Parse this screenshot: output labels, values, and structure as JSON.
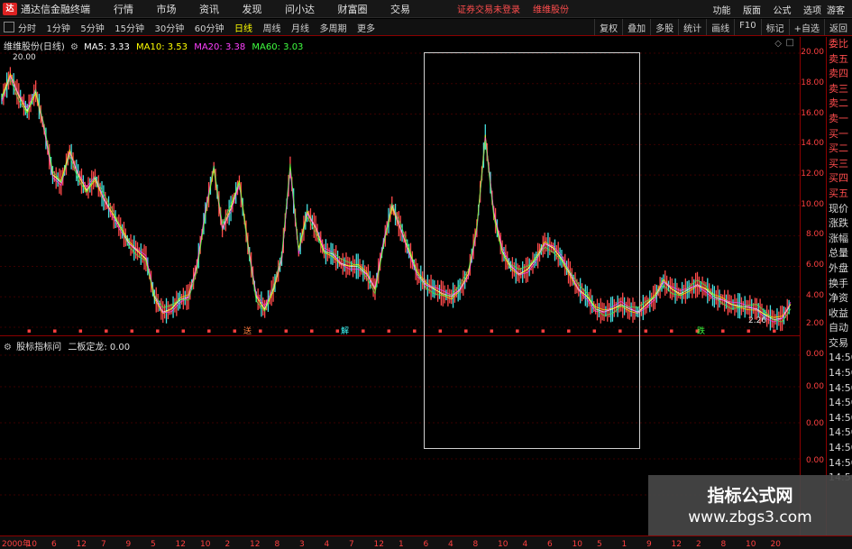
{
  "app": {
    "title": "通达信金融终端",
    "menu": [
      "行情",
      "市场",
      "资讯",
      "发现",
      "问小达",
      "财富圈",
      "交易"
    ],
    "warning": "证券交易未登录",
    "stock": "维维股份",
    "right_menu": [
      "功能",
      "版面",
      "公式",
      "选项"
    ],
    "guest": "游客"
  },
  "toolbar": {
    "periods": [
      "分时",
      "1分钟",
      "5分钟",
      "15分钟",
      "30分钟",
      "60分钟",
      "日线",
      "周线",
      "月线",
      "多周期",
      "更多"
    ],
    "active_period": "日线",
    "right_tools": [
      "复权",
      "叠加",
      "多股",
      "统计",
      "画线",
      "F10",
      "标记",
      "+自选",
      "返回"
    ]
  },
  "main_chart": {
    "title": "维维股份(日线)",
    "ma": [
      {
        "label": "MA5: 3.33",
        "color": "#ffffff"
      },
      {
        "label": "MA10: 3.53",
        "color": "#ffff00"
      },
      {
        "label": "MA20: 3.38",
        "color": "#ff40ff"
      },
      {
        "label": "MA60: 3.03",
        "color": "#40ff40"
      }
    ],
    "max_label": "20.00",
    "min_label": "2.26",
    "y_ticks": [
      "20.00",
      "18.00",
      "16.00",
      "14.00",
      "12.00",
      "10.00",
      "8.00",
      "6.00",
      "4.00",
      "2.00"
    ],
    "markers": [
      "送",
      "解",
      "跌"
    ]
  },
  "chart_data": {
    "type": "line",
    "y": [
      17.0,
      18.5,
      17.2,
      16.2,
      17.5,
      15.0,
      12.0,
      11.5,
      13.5,
      12.0,
      11.0,
      11.8,
      10.5,
      9.5,
      8.5,
      7.5,
      7.0,
      6.5,
      4.0,
      3.0,
      3.2,
      3.8,
      4.0,
      6.0,
      9.5,
      12.5,
      8.5,
      9.8,
      11.5,
      7.5,
      4.0,
      3.2,
      4.5,
      6.5,
      12.5,
      7.0,
      9.5,
      8.5,
      7.0,
      6.8,
      6.2,
      6.0,
      6.0,
      5.5,
      4.5,
      7.5,
      10.0,
      8.5,
      7.0,
      5.5,
      4.8,
      4.5,
      4.2,
      4.0,
      4.5,
      5.5,
      8.5,
      14.5,
      9.5,
      7.0,
      6.0,
      5.5,
      5.8,
      6.5,
      7.5,
      7.2,
      6.5,
      5.5,
      4.5,
      4.0,
      3.2,
      3.0,
      3.2,
      3.5,
      3.2,
      3.0,
      3.5,
      4.0,
      5.0,
      4.5,
      4.2,
      4.5,
      4.8,
      4.5,
      4.0,
      3.8,
      3.5,
      3.4,
      3.3,
      3.2,
      2.8,
      2.5,
      2.6,
      3.5
    ],
    "ylim": [
      2.0,
      20.0
    ],
    "series": [
      {
        "name": "MA5",
        "color": "#ffffff"
      },
      {
        "name": "MA10",
        "color": "#ffff00"
      },
      {
        "name": "MA20",
        "color": "#ff40ff"
      },
      {
        "name": "MA60",
        "color": "#40ff40"
      }
    ]
  },
  "sub_chart": {
    "title": "股标指标问",
    "indicator": "二板定龙: 0.00",
    "y_ticks": [
      "0.00",
      "0.00",
      "0.00",
      "0.00"
    ]
  },
  "side_panel": [
    "委比",
    "卖五",
    "卖四",
    "卖三",
    "卖二",
    "卖一",
    "买一",
    "买二",
    "买三",
    "买四",
    "买五",
    "现价",
    "涨跌",
    "涨幅",
    "总量",
    "外盘",
    "换手",
    "净资",
    "收益",
    "自动",
    "交易",
    "14:50",
    "14:50",
    "14:50",
    "14:50",
    "14:50",
    "14:50",
    "14:50",
    "14:50",
    "14:50"
  ],
  "x_axis": {
    "labels": [
      "2000年",
      "10",
      "6",
      "12",
      "7",
      "9",
      "5",
      "12",
      "10",
      "2",
      "12",
      "8",
      "3",
      "4",
      "7",
      "12",
      "1",
      "6",
      "4",
      "8",
      "10",
      "4",
      "6",
      "10",
      "5",
      "1",
      "9",
      "12",
      "2",
      "8",
      "10",
      "20"
    ]
  },
  "watermark": {
    "line1": "指标公式网",
    "line2": "www.zbgs3.com"
  }
}
